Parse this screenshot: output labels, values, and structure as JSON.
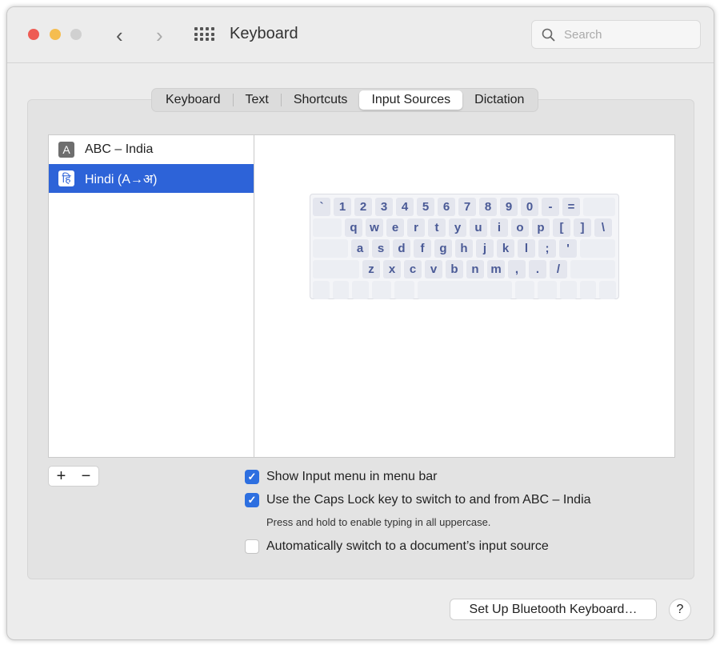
{
  "window": {
    "title": "Keyboard",
    "search_placeholder": "Search",
    "back": "‹",
    "forward": "›"
  },
  "tabs": [
    {
      "label": "Keyboard"
    },
    {
      "label": "Text"
    },
    {
      "label": "Shortcuts"
    },
    {
      "label": "Input Sources",
      "selected": true
    },
    {
      "label": "Dictation"
    }
  ],
  "sources": [
    {
      "icon": "A",
      "label": "ABC – India"
    },
    {
      "icon": "हि",
      "label": "Hindi (A→अ)",
      "selected": true
    }
  ],
  "keyboard": {
    "rows": [
      [
        "`",
        "1",
        "2",
        "3",
        "4",
        "5",
        "6",
        "7",
        "8",
        "9",
        "0",
        "-",
        "="
      ],
      [
        "q",
        "w",
        "e",
        "r",
        "t",
        "y",
        "u",
        "i",
        "o",
        "p",
        "[",
        "]",
        "\\"
      ],
      [
        "a",
        "s",
        "d",
        "f",
        "g",
        "h",
        "j",
        "k",
        "l",
        ";",
        "'"
      ],
      [
        "z",
        "x",
        "c",
        "v",
        "b",
        "n",
        "m",
        ",",
        ".",
        "/"
      ]
    ]
  },
  "add_label": "+",
  "remove_label": "−",
  "options": {
    "show_menu": {
      "label": "Show Input menu in menu bar",
      "checked": true
    },
    "caps_lock": {
      "label": "Use the Caps Lock key to switch to and from ABC – India",
      "checked": true,
      "note": "Press and hold to enable typing in all uppercase."
    },
    "auto_switch": {
      "label": "Automatically switch to a document’s input source",
      "checked": false
    }
  },
  "bluetooth_button": "Set Up Bluetooth Keyboard…",
  "help": "?",
  "colors": {
    "accent": "#2d63d8",
    "key_text": "#4a5a96"
  }
}
